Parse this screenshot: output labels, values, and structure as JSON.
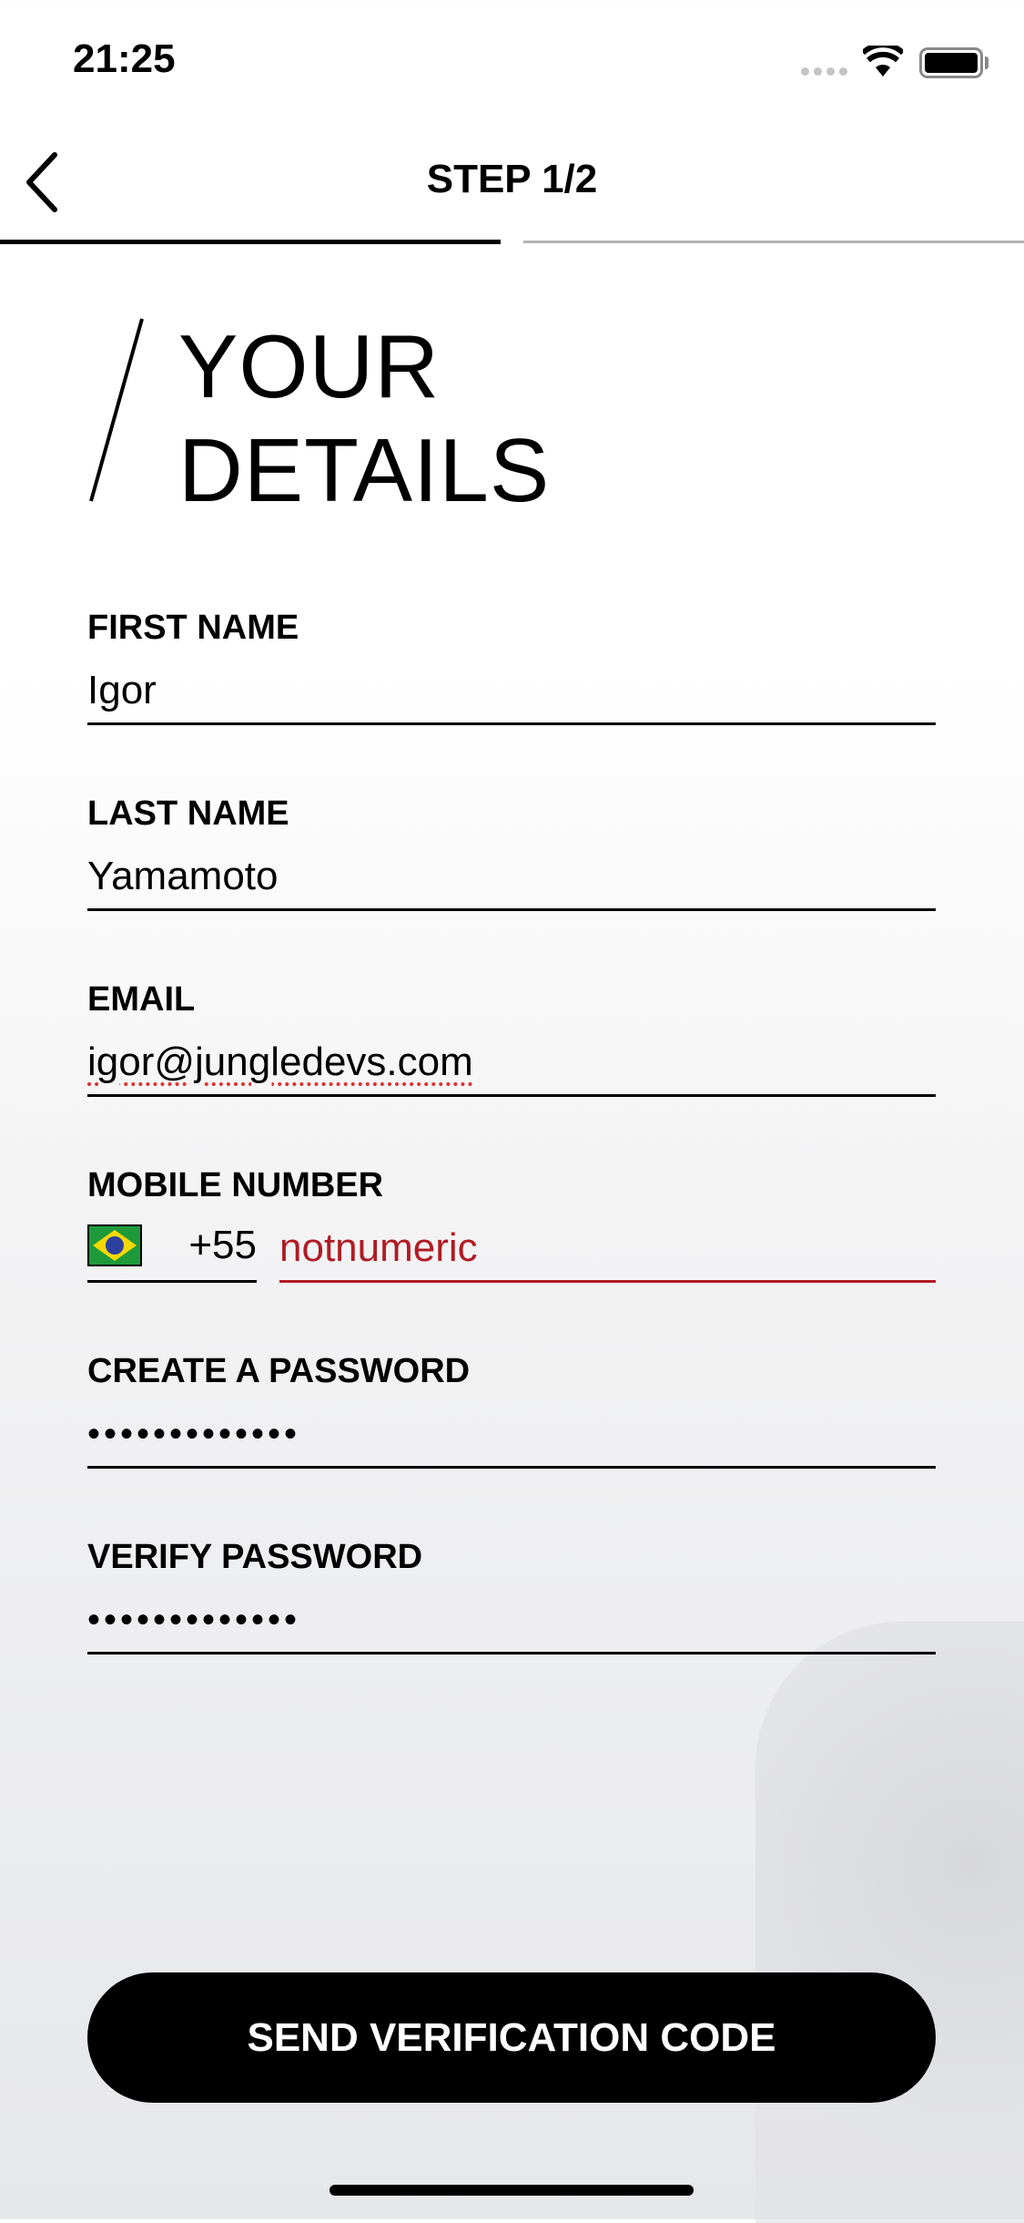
{
  "status_bar": {
    "time": "21:25"
  },
  "header": {
    "title": "STEP 1/2",
    "progress_step": 1,
    "progress_total": 2
  },
  "heading": {
    "line1": "YOUR",
    "line2": "DETAILS"
  },
  "form": {
    "first_name": {
      "label": "FIRST NAME",
      "value": "Igor"
    },
    "last_name": {
      "label": "LAST NAME",
      "value": "Yamamoto"
    },
    "email": {
      "label": "EMAIL",
      "value": "igor@jungledevs.com"
    },
    "mobile": {
      "label": "MOBILE NUMBER",
      "country_code": "+55",
      "value": "notnumeric",
      "error_color": "#b01c26"
    },
    "password": {
      "label": "CREATE A PASSWORD",
      "value": "•••••••••••••"
    },
    "verify_password": {
      "label": "VERIFY PASSWORD",
      "value": "•••••••••••••"
    }
  },
  "button": {
    "label": "SEND VERIFICATION CODE"
  }
}
